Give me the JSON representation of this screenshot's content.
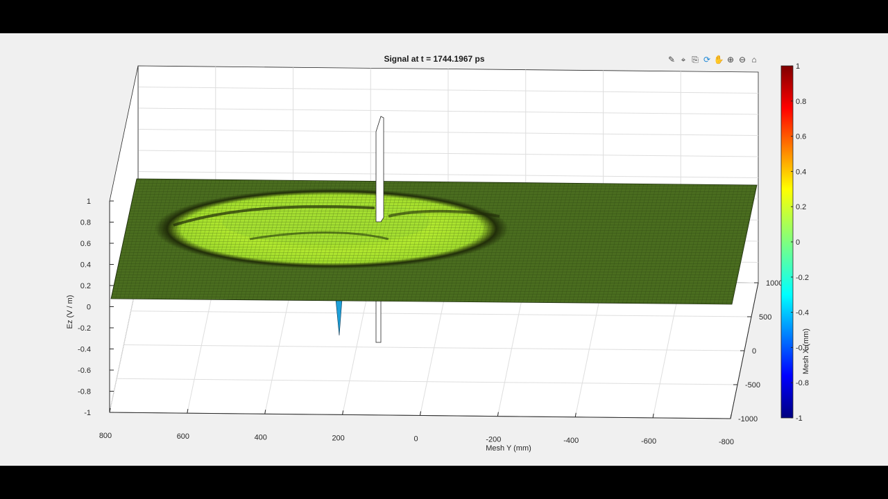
{
  "chart_data": {
    "type": "surface",
    "title": "Signal at t = 1744.1967 ps",
    "xlabel": "Mesh Y (mm)",
    "ylabel": "Mesh X (mm)",
    "zlabel": "Ez (V / m)",
    "x_ticks": [
      "800",
      "600",
      "400",
      "200",
      "0",
      "-200",
      "-400",
      "-600",
      "-800"
    ],
    "y_ticks": [
      "1000",
      "500",
      "0",
      "-500",
      "-1000"
    ],
    "z_ticks": [
      "1",
      "0.8",
      "0.6",
      "0.4",
      "0.2",
      "0",
      "-0.2",
      "-0.4",
      "-0.6",
      "-0.8",
      "-1"
    ],
    "zlim": [
      -1,
      1
    ],
    "xlim": [
      800,
      -800
    ],
    "ylim": [
      -1000,
      1000
    ],
    "colormap": "jet",
    "colorbar": {
      "ticks": [
        "1",
        "0.8",
        "0.6",
        "0.4",
        "0.2",
        "0",
        "-0.2",
        "-0.4",
        "-0.6",
        "-0.8",
        "-1"
      ],
      "range": [
        -1,
        1
      ]
    },
    "grid": true,
    "plane_level": 0.1,
    "features": [
      {
        "kind": "ring wave",
        "center_x": 250,
        "center_y": 200,
        "peak": 0.25
      },
      {
        "kind": "source spike",
        "x": 0,
        "y": 0,
        "z_range": [
          -0.35,
          0.95
        ]
      },
      {
        "kind": "negative spike",
        "x": 200,
        "y": -200,
        "z_min": -0.28
      }
    ]
  },
  "toolbar": {
    "icons": [
      "brush-icon",
      "datatip-icon",
      "export-icon",
      "rotate-icon",
      "pan-icon",
      "zoom-in-icon",
      "zoom-out-icon",
      "home-icon"
    ]
  },
  "colors": {
    "plane_fill": "#4a6d1f",
    "ring_light": "#b8f030",
    "mesh_line": "#1a2a0a",
    "grid": "#dedede",
    "axis": "#262626"
  }
}
